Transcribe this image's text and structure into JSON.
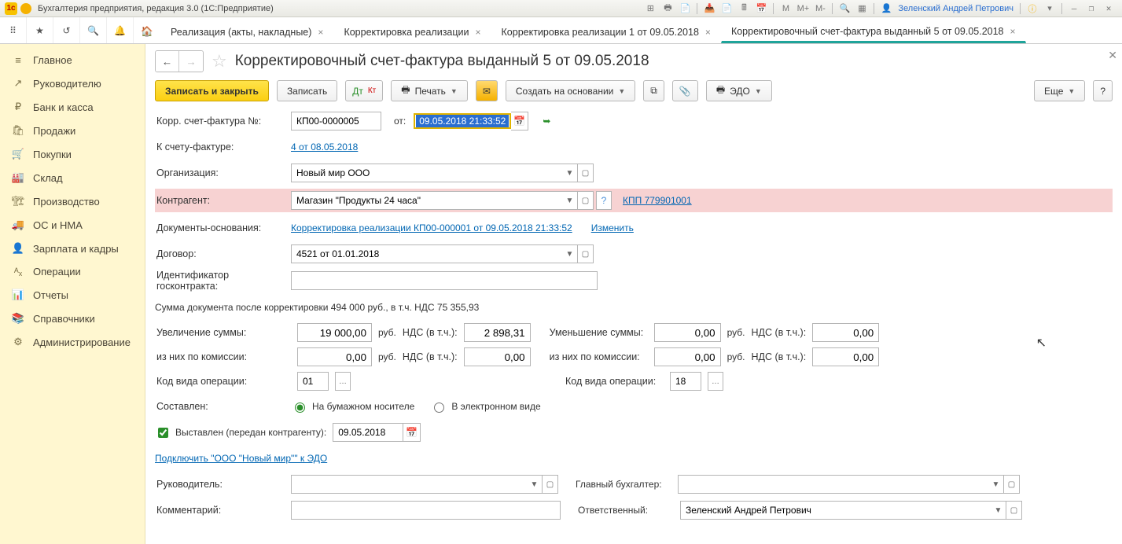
{
  "titlebar": {
    "app_title": "Бухгалтерия предприятия, редакция 3.0  (1С:Предприятие)",
    "user": "Зеленский Андрей Петрович",
    "m": "M",
    "mp": "M+",
    "mm": "M-"
  },
  "tabs": {
    "items": [
      {
        "label": "Реализация (акты, накладные)",
        "active": false
      },
      {
        "label": "Корректировка реализации",
        "active": false
      },
      {
        "label": "Корректировка реализации 1 от 09.05.2018",
        "active": false
      },
      {
        "label": "Корректировочный счет-фактура выданный 5 от 09.05.2018",
        "active": true
      }
    ]
  },
  "sidebar": {
    "items": [
      {
        "label": "Главное",
        "icon": "≡"
      },
      {
        "label": "Руководителю",
        "icon": "↗"
      },
      {
        "label": "Банк и касса",
        "icon": "₽"
      },
      {
        "label": "Продажи",
        "icon": "🛍"
      },
      {
        "label": "Покупки",
        "icon": "🛒"
      },
      {
        "label": "Склад",
        "icon": "🏭"
      },
      {
        "label": "Производство",
        "icon": "🏗"
      },
      {
        "label": "ОС и НМА",
        "icon": "🚚"
      },
      {
        "label": "Зарплата и кадры",
        "icon": "👤"
      },
      {
        "label": "Операции",
        "icon": "ᴬₓ"
      },
      {
        "label": "Отчеты",
        "icon": "📊"
      },
      {
        "label": "Справочники",
        "icon": "📚"
      },
      {
        "label": "Администрирование",
        "icon": "⚙"
      }
    ]
  },
  "header": {
    "title": "Корректировочный счет-фактура выданный 5 от 09.05.2018"
  },
  "toolbar": {
    "save_close": "Записать и закрыть",
    "save": "Записать",
    "print": "Печать",
    "create_based": "Создать на основании",
    "edo": "ЭДО",
    "more": "Еще"
  },
  "form": {
    "number_label": "Корр. счет-фактура №:",
    "number": "КП00-0000005",
    "from": "от:",
    "date": "09.05.2018 21:33:52",
    "to_invoice_label": "К счету-фактуре:",
    "to_invoice_link": "4 от 08.05.2018",
    "org_label": "Организация:",
    "org": "Новый мир ООО",
    "counterparty_label": "Контрагент:",
    "counterparty": "Магазин \"Продукты 24 часа\"",
    "kpp": "КПП 779901001",
    "basis_label": "Документы-основания:",
    "basis_link": "Корректировка реализации КП00-000001 от 09.05.2018 21:33:52",
    "basis_change": "Изменить",
    "contract_label": "Договор:",
    "contract": "4521 от 01.01.2018",
    "goscontract_label": "Идентификатор госконтракта:",
    "goscontract": "",
    "sum_text": "Сумма документа после корректировки 494 000 руб., в т.ч. НДС 75 355,93",
    "inc_label": "Увеличение суммы:",
    "inc_val": "19 000,00",
    "rub": "руб.",
    "nds_label": "НДС (в т.ч.):",
    "inc_nds": "2 898,31",
    "dec_label": "Уменьшение суммы:",
    "dec_val": "0,00",
    "dec_nds": "0,00",
    "comm_label": "из них по комиссии:",
    "comm_val": "0,00",
    "comm_nds": "0,00",
    "comm_val2": "0,00",
    "comm_nds2": "0,00",
    "code_label": "Код вида операции:",
    "code1": "01",
    "code2": "18",
    "compiled_label": "Составлен:",
    "radio_paper": "На бумажном носителе",
    "radio_elec": "В электронном виде",
    "issued_label": "Выставлен (передан контрагенту):",
    "issued_date": "09.05.2018",
    "edo_link": "Подключить \"ООО \"Новый мир\"\" к ЭДО",
    "director_label": "Руководитель:",
    "accountant_label": "Главный бухгалтер:",
    "comment_label": "Комментарий:",
    "responsible_label": "Ответственный:",
    "responsible": "Зеленский Андрей Петрович"
  }
}
